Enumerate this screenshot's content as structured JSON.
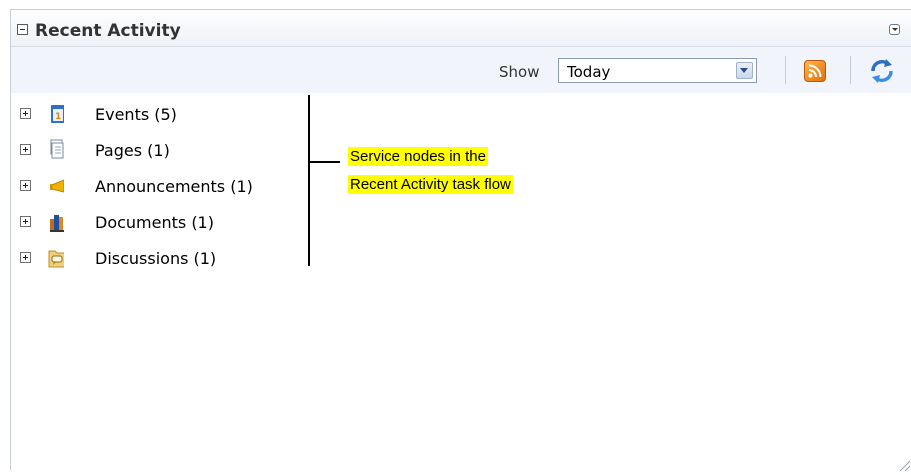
{
  "panel": {
    "title": "Recent Activity",
    "icons": {
      "collapse": "collapse-minus-icon",
      "menu": "panel-menu-icon"
    }
  },
  "toolbar": {
    "show_label": "Show",
    "filter": {
      "selected": "Today"
    },
    "icons": {
      "feed": "rss-feed-icon",
      "refresh": "refresh-icon"
    }
  },
  "tree": {
    "items": [
      {
        "label": "Events (5)",
        "icon": "calendar-icon"
      },
      {
        "label": "Pages (1)",
        "icon": "pages-icon"
      },
      {
        "label": "Announcements (1)",
        "icon": "megaphone-icon"
      },
      {
        "label": "Documents (1)",
        "icon": "documents-icon"
      },
      {
        "label": "Discussions (1)",
        "icon": "discussion-folder-icon"
      }
    ]
  },
  "annotation": {
    "line1": "Service nodes in the",
    "line2": "Recent Activity task flow",
    "highlight_color": "#ffff00"
  },
  "colors": {
    "header_bg": "#eef2f7",
    "toolbar_bg": "#f1f5fb",
    "rss": "#e2700c",
    "refresh": "#2a6fc0"
  }
}
